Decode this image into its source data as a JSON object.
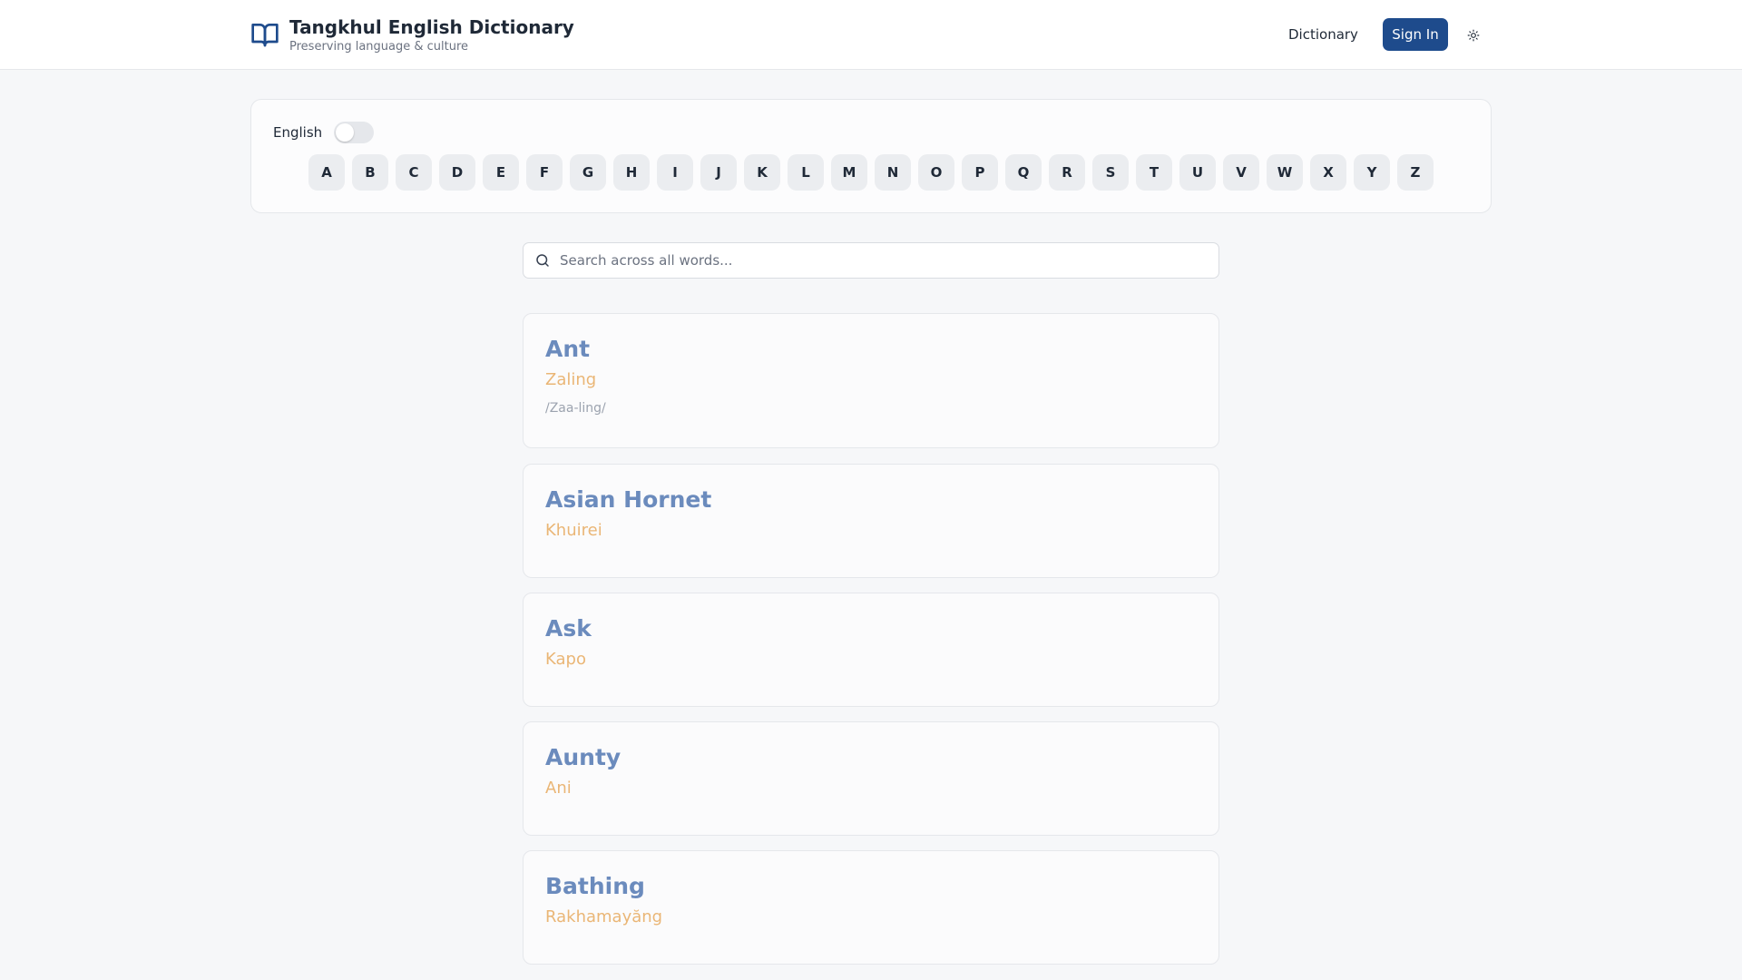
{
  "header": {
    "title": "Tangkhul English Dictionary",
    "subtitle": "Preserving language & culture",
    "nav_dictionary": "Dictionary",
    "sign_in": "Sign In",
    "theme_icon": "sun-icon",
    "brand_icon": "open-book-icon",
    "brand_color": "#1e4b8c"
  },
  "language_toggle": {
    "label": "English",
    "enabled": false
  },
  "alphabet": [
    "A",
    "B",
    "C",
    "D",
    "E",
    "F",
    "G",
    "H",
    "I",
    "J",
    "K",
    "L",
    "M",
    "N",
    "O",
    "P",
    "Q",
    "R",
    "S",
    "T",
    "U",
    "V",
    "W",
    "X",
    "Y",
    "Z"
  ],
  "search": {
    "placeholder": "Search across all words...",
    "value": "",
    "icon": "search-icon"
  },
  "entries": [
    {
      "word": "Ant",
      "translation": "Zaling",
      "pronunciation": "/Zaa-ling/"
    },
    {
      "word": "Asian Hornet",
      "translation": "Khuirei",
      "pronunciation": ""
    },
    {
      "word": "Ask",
      "translation": "Kapo",
      "pronunciation": ""
    },
    {
      "word": "Aunty",
      "translation": "Ani",
      "pronunciation": ""
    },
    {
      "word": "Bathing",
      "translation": "Rakhamayăng",
      "pronunciation": ""
    }
  ],
  "colors": {
    "word": "#6b8bbd",
    "translation": "#eab676",
    "accent": "#1e4b8c"
  }
}
